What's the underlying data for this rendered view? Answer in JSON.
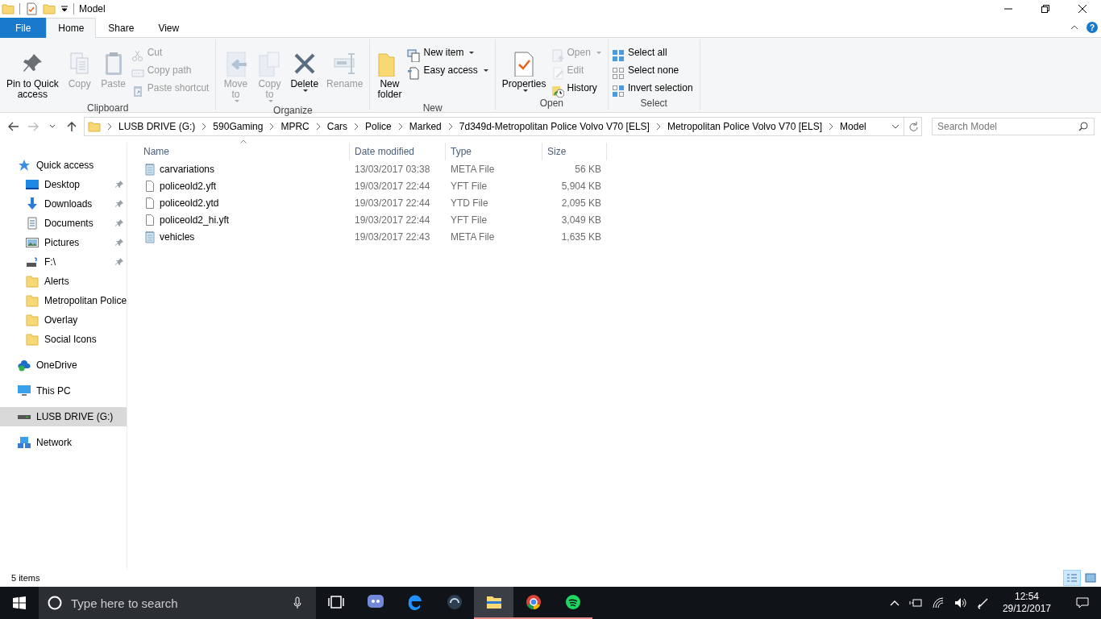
{
  "window": {
    "title": "Model"
  },
  "ribbon_tabs": [
    {
      "label": "File",
      "kind": "file",
      "selected": false
    },
    {
      "label": "Home",
      "kind": "tab",
      "selected": true
    },
    {
      "label": "Share",
      "kind": "tab",
      "selected": false
    },
    {
      "label": "View",
      "kind": "tab",
      "selected": false
    }
  ],
  "help": "?",
  "ribbon_groups": [
    {
      "label": "Clipboard",
      "items": [
        {
          "label": "Pin to Quick\naccess",
          "kind": "large",
          "disabled": false,
          "caret": false
        },
        {
          "label": "Copy",
          "kind": "large",
          "disabled": true,
          "caret": false
        },
        {
          "label": "Paste",
          "kind": "large",
          "disabled": true,
          "caret": false
        },
        {
          "label": "Cut",
          "kind": "small",
          "disabled": true,
          "caret": false
        },
        {
          "label": "Copy path",
          "kind": "small",
          "disabled": true,
          "caret": false
        },
        {
          "label": "Paste shortcut",
          "kind": "small",
          "disabled": true,
          "caret": false
        }
      ]
    },
    {
      "label": "Organize",
      "items": [
        {
          "label": "Move\nto",
          "kind": "large",
          "disabled": true,
          "caret": true
        },
        {
          "label": "Copy\nto",
          "kind": "large",
          "disabled": true,
          "caret": true
        },
        {
          "label": "Delete",
          "kind": "large",
          "disabled": false,
          "caret": true
        },
        {
          "label": "Rename",
          "kind": "large",
          "disabled": true,
          "caret": false
        }
      ]
    },
    {
      "label": "New",
      "items": [
        {
          "label": "New\nfolder",
          "kind": "large",
          "disabled": false,
          "caret": false
        },
        {
          "label": "New item",
          "kind": "small",
          "disabled": false,
          "caret": true
        },
        {
          "label": "Easy access",
          "kind": "small",
          "disabled": false,
          "caret": true
        }
      ]
    },
    {
      "label": "Open",
      "items": [
        {
          "label": "Properties",
          "kind": "large",
          "disabled": false,
          "caret": true
        },
        {
          "label": "Open",
          "kind": "small",
          "disabled": true,
          "caret": true
        },
        {
          "label": "Edit",
          "kind": "small",
          "disabled": true,
          "caret": false
        },
        {
          "label": "History",
          "kind": "small",
          "disabled": false,
          "caret": false
        }
      ]
    },
    {
      "label": "Select",
      "items": [
        {
          "label": "Select all",
          "kind": "small",
          "disabled": false,
          "caret": false
        },
        {
          "label": "Select none",
          "kind": "small",
          "disabled": false,
          "caret": false
        },
        {
          "label": "Invert selection",
          "kind": "small",
          "disabled": false,
          "caret": false
        }
      ]
    }
  ],
  "address": {
    "crumbs": [
      "LUSB DRIVE (G:)",
      "590Gaming",
      "MPRC",
      "Cars",
      "Police",
      "Marked",
      "7d349d-Metropolitan Police Volvo V70 [ELS]",
      "Metropolitan Police Volvo V70 [ELS]",
      "Model"
    ]
  },
  "search": {
    "placeholder": "Search Model"
  },
  "sidebar": {
    "items": [
      {
        "label": "Quick access",
        "kind": "star",
        "selected": false,
        "children": [
          {
            "label": "Desktop",
            "kind": "desktop",
            "pinned": true,
            "selected": false
          },
          {
            "label": "Downloads",
            "kind": "download",
            "pinned": true,
            "selected": false
          },
          {
            "label": "Documents",
            "kind": "documents",
            "pinned": true,
            "selected": false
          },
          {
            "label": "Pictures",
            "kind": "pictures",
            "pinned": true,
            "selected": false
          },
          {
            "label": "F:\\",
            "kind": "drive",
            "pinned": true,
            "selected": false
          },
          {
            "label": "Alerts",
            "kind": "folder",
            "pinned": false,
            "selected": false
          },
          {
            "label": "Metropolitan Police",
            "kind": "folder",
            "pinned": false,
            "selected": false
          },
          {
            "label": "Overlay",
            "kind": "folder",
            "pinned": false,
            "selected": false
          },
          {
            "label": "Social Icons",
            "kind": "folder",
            "pinned": false,
            "selected": false
          }
        ]
      },
      {
        "label": "OneDrive",
        "kind": "cloud",
        "selected": false
      },
      {
        "label": "This PC",
        "kind": "pc",
        "selected": false
      },
      {
        "label": "LUSB DRIVE (G:)",
        "kind": "usb",
        "selected": true
      },
      {
        "label": "Network",
        "kind": "network",
        "selected": false
      }
    ]
  },
  "table": {
    "columns": [
      "Name",
      "Date modified",
      "Type",
      "Size"
    ],
    "rows": [
      {
        "name": "carvariations",
        "date": "13/03/2017 03:38",
        "type": "META File",
        "size": "56 KB",
        "kind": "text"
      },
      {
        "name": "policeold2.yft",
        "date": "19/03/2017 22:44",
        "type": "YFT File",
        "size": "5,904 KB",
        "kind": "blank"
      },
      {
        "name": "policeold2.ytd",
        "date": "19/03/2017 22:44",
        "type": "YTD File",
        "size": "2,095 KB",
        "kind": "blank"
      },
      {
        "name": "policeold2_hi.yft",
        "date": "19/03/2017 22:44",
        "type": "YFT File",
        "size": "3,049 KB",
        "kind": "blank"
      },
      {
        "name": "vehicles",
        "date": "19/03/2017 22:43",
        "type": "META File",
        "size": "1,635 KB",
        "kind": "text"
      }
    ]
  },
  "status_bar": {
    "text": "5 items",
    "views": [
      {
        "kind": "details",
        "selected": true
      },
      {
        "kind": "large",
        "selected": false
      }
    ]
  },
  "taskbar": {
    "search_placeholder": "Type here to search",
    "apps": [
      {
        "kind": "taskview",
        "running": false,
        "selected": false
      },
      {
        "kind": "discord",
        "running": false,
        "selected": false
      },
      {
        "kind": "edge",
        "running": false,
        "selected": false
      },
      {
        "kind": "teamspeak",
        "running": false,
        "selected": false
      },
      {
        "kind": "explorer",
        "running": true,
        "selected": true
      },
      {
        "kind": "chrome",
        "running": true,
        "selected": false
      },
      {
        "kind": "spotify",
        "running": true,
        "selected": false
      }
    ],
    "time": "12:54",
    "date": "29/12/2017"
  }
}
